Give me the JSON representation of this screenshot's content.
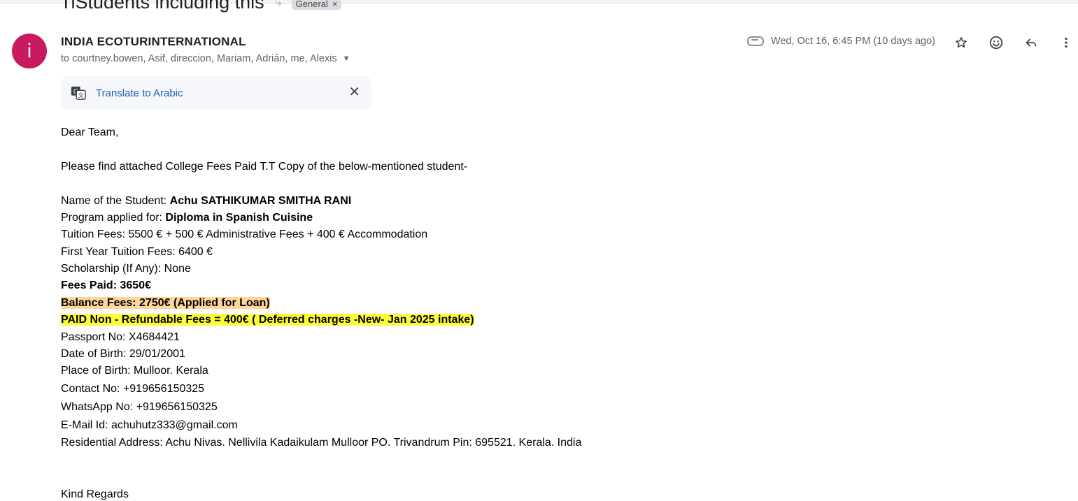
{
  "subject": {
    "text": "TiStudents including this",
    "label": "General",
    "label_remove": "×"
  },
  "sender": {
    "initial": "i",
    "name": "INDIA ECOTURINTERNATIONAL",
    "recipients": "to courtney.bowen, Asif, direccion, Mariam, Adrián, me, Alexis"
  },
  "meta": {
    "date": "Wed, Oct 16, 6:45 PM (10 days ago)"
  },
  "translate": {
    "label": "Translate to Arabic"
  },
  "body": {
    "greeting": "Dear Team,",
    "intro": "Please find attached College Fees Paid T.T Copy of the below-mentioned student-",
    "student_label": "Name of the Student: ",
    "student_value": "Achu SATHIKUMAR SMITHA RANI",
    "program_label": "Program applied for: ",
    "program_value": "Diploma in Spanish Cuisine",
    "tuition": "Tuition Fees: 5500 € + 500 € Administrative Fees + 400 € Accommodation",
    "first_year": "First Year Tuition Fees: 6400 €",
    "scholarship": "Scholarship (If Any): None",
    "fees_paid": "Fees Paid: 3650€",
    "balance": "Balance Fees: 2750€ (Applied for Loan)",
    "non_refundable": "PAID Non - Refundable Fees = 400€  ( Deferred charges -New- Jan 2025 intake)",
    "passport": "Passport No: X4684421",
    "dob": "Date of Birth: 29/01/2001",
    "pob": "Place of Birth: Mulloor. Kerala",
    "contact": "Contact No: +919656150325",
    "whatsapp": "WhatsApp No: +919656150325",
    "email": "E-Mail Id: achuhutz333@gmail.com",
    "address": "Residential Address: Achu Nivas. Nellivila Kadaikulam Mulloor PO. Trivandrum Pin: 695521. Kerala. India",
    "closing": "Kind Regards"
  },
  "colors": {
    "avatar": "#c9195f",
    "link": "#1a5fb4",
    "highlight_orange": "#ffd59a",
    "highlight_yellow": "#ffff36"
  },
  "icons": [
    "important-marker-icon",
    "attachment-icon",
    "star-icon",
    "emoji-icon",
    "reply-icon",
    "more-vert-icon",
    "translate-icon",
    "close-icon",
    "chevron-down-icon"
  ]
}
